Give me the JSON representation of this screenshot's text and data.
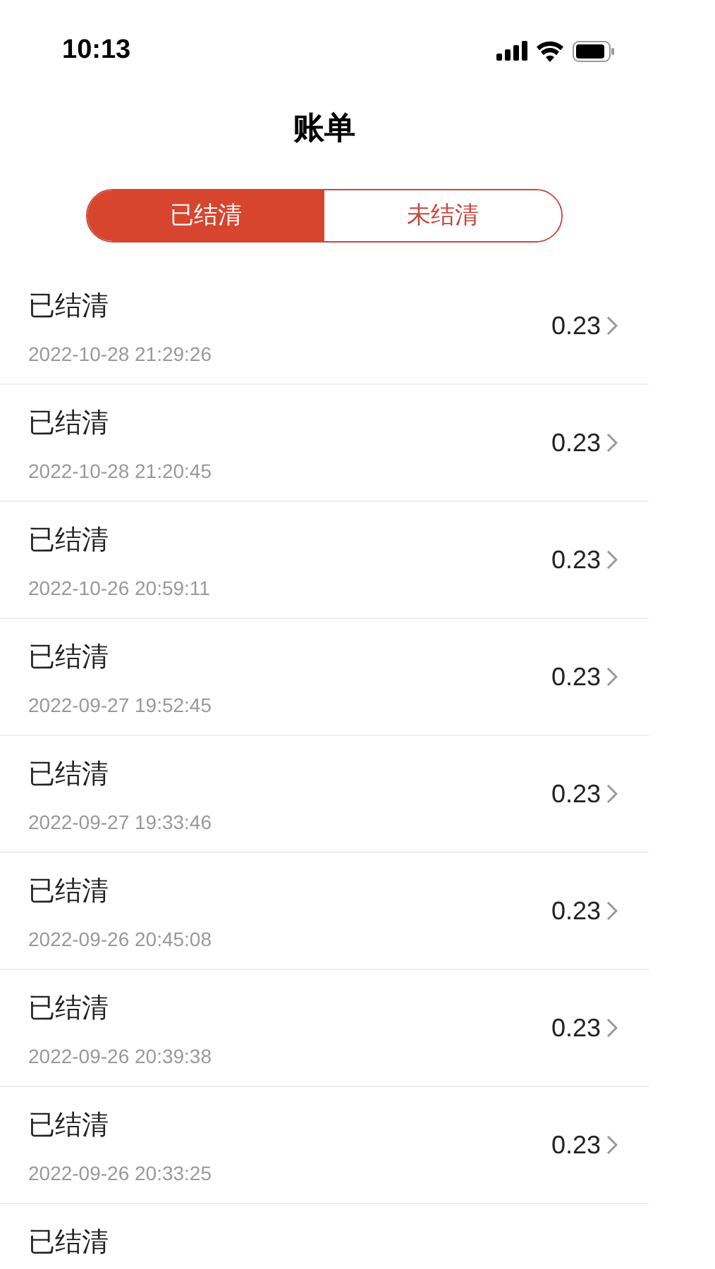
{
  "status_bar": {
    "time": "10:13"
  },
  "title": "账单",
  "tabs": [
    {
      "label": "已结清",
      "selected": true
    },
    {
      "label": "未结清",
      "selected": false
    }
  ],
  "bills": [
    {
      "status": "已结清",
      "time": "2022-10-28 21:29:26",
      "amount": "0.23"
    },
    {
      "status": "已结清",
      "time": "2022-10-28 21:20:45",
      "amount": "0.23"
    },
    {
      "status": "已结清",
      "time": "2022-10-26 20:59:11",
      "amount": "0.23"
    },
    {
      "status": "已结清",
      "time": "2022-09-27 19:52:45",
      "amount": "0.23"
    },
    {
      "status": "已结清",
      "time": "2022-09-27 19:33:46",
      "amount": "0.23"
    },
    {
      "status": "已结清",
      "time": "2022-09-26 20:45:08",
      "amount": "0.23"
    },
    {
      "status": "已结清",
      "time": "2022-09-26 20:39:38",
      "amount": "0.23"
    },
    {
      "status": "已结清",
      "time": "2022-09-26 20:33:25",
      "amount": "0.23"
    },
    {
      "status": "已结清"
    }
  ]
}
